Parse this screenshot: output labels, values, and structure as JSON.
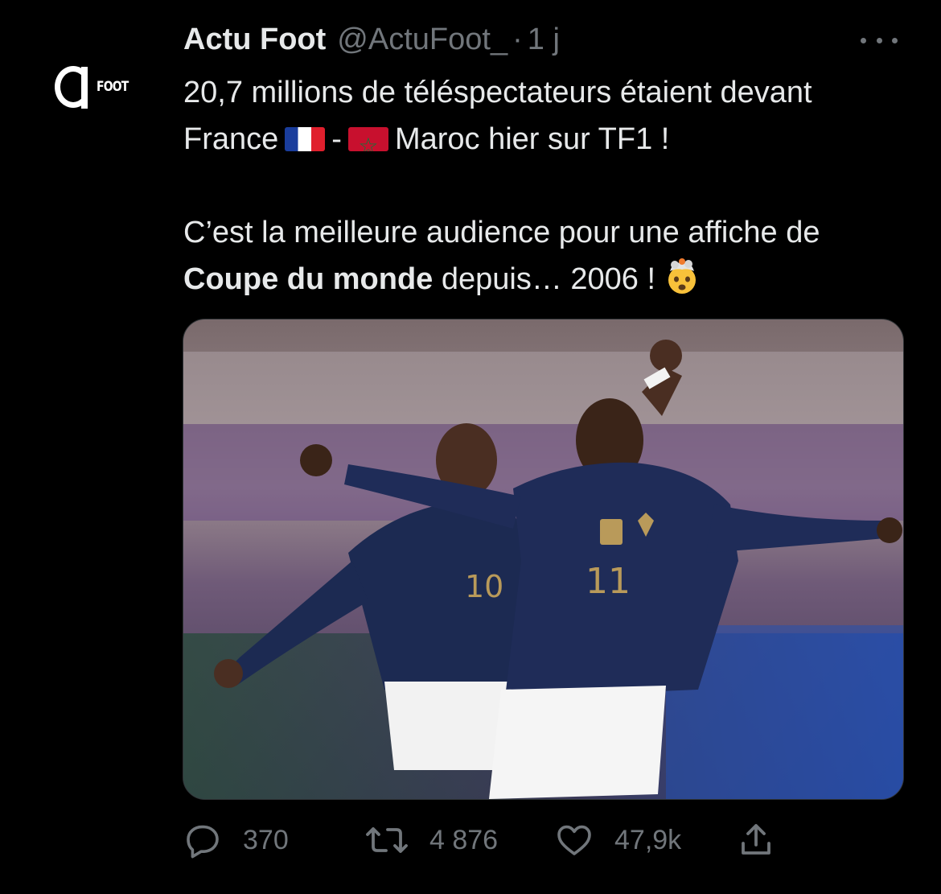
{
  "tweet": {
    "author": {
      "display_name": "Actu Foot",
      "handle": "@ActuFoot_",
      "avatar_text": "FOOT",
      "avatar_icon": "actufoot-logo"
    },
    "separator": "·",
    "time": "1 j",
    "more_icon": "more-dots-icon",
    "text": {
      "line1_prefix": "20,7 millions de téléspectateurs étaient devant France",
      "dash": "-",
      "line1_suffix": "Maroc hier sur TF1 !",
      "para2_prefix": "C’est la meilleure audience pour une affiche de",
      "para2_bold": "Coupe du monde",
      "para2_suffix": "depuis… 2006 !",
      "emoji_icons": [
        "flag-france-icon",
        "flag-morocco-icon",
        "mind-blown-emoji-icon"
      ]
    },
    "media": {
      "jersey_numbers": [
        "10",
        "11"
      ]
    },
    "actions": {
      "reply": {
        "icon": "reply-icon",
        "count": "370"
      },
      "retweet": {
        "icon": "retweet-icon",
        "count": "4 876"
      },
      "like": {
        "icon": "heart-icon",
        "count": "47,9k"
      },
      "share": {
        "icon": "share-icon"
      }
    },
    "colors": {
      "background": "#000000",
      "text_primary": "#e7e9ea",
      "text_secondary": "#71767b",
      "jersey": "#1c2a52",
      "jersey_gold": "#b99a5a"
    }
  }
}
